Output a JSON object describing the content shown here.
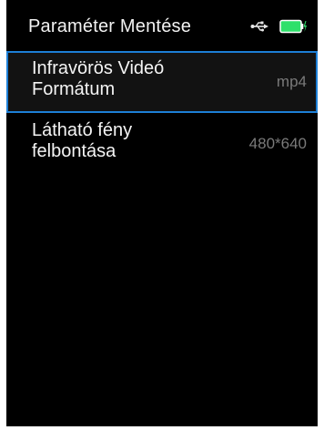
{
  "screen": {
    "title": "Paraméter Mentése",
    "status_icons": {
      "usb": "usb-icon",
      "battery": "battery-charging-icon",
      "battery_color": "#2ee06a",
      "charge_color": "#2ee06a"
    }
  },
  "settings": {
    "items": [
      {
        "label_line1": "Infravörös Videó",
        "label_line2": "Formátum",
        "value": "mp4",
        "selected": true
      },
      {
        "label_line1": "Látható fény",
        "label_line2": "felbontása",
        "value": "480*640",
        "selected": false
      }
    ]
  },
  "colors": {
    "background": "#000000",
    "selection_border": "#1d7fd6",
    "text": "#f4f4f4",
    "value_text": "#7a7a7a"
  }
}
